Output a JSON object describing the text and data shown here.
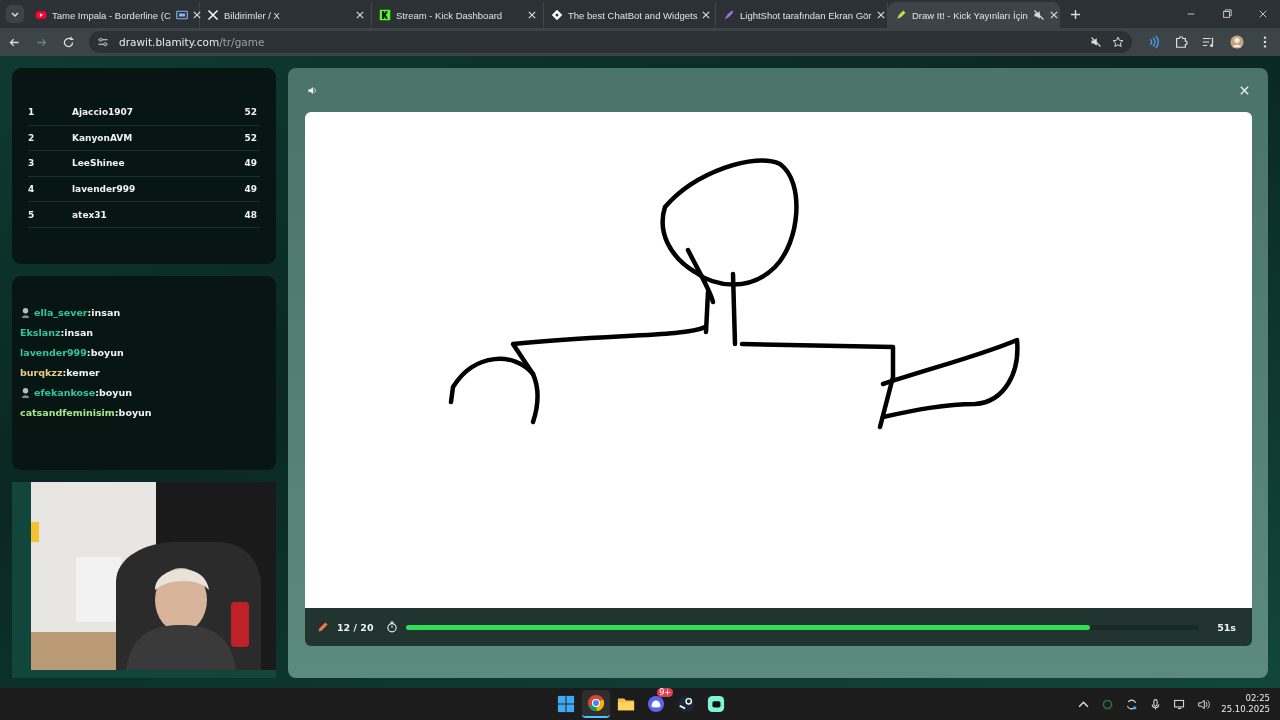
{
  "tabs": [
    {
      "title": "Tame Impala - Borderline (C",
      "kind": "youtube",
      "selected": false,
      "casting": true,
      "muted": false
    },
    {
      "title": "Bildirimler / X",
      "kind": "x",
      "selected": false,
      "casting": false,
      "muted": false
    },
    {
      "title": "Stream - Kick Dashboard",
      "kind": "kick",
      "selected": false,
      "casting": false,
      "muted": false
    },
    {
      "title": "The best ChatBot and Widgets",
      "kind": "chatbot",
      "selected": false,
      "casting": false,
      "muted": false
    },
    {
      "title": "LightShot tarafından Ekran Gör",
      "kind": "feather",
      "selected": false,
      "casting": false,
      "muted": false
    },
    {
      "title": "Draw It! - Kick Yayınları İçin",
      "kind": "drawit",
      "selected": true,
      "casting": false,
      "muted": true
    }
  ],
  "address_bar": {
    "host": "drawit.blamity.com",
    "path": "/tr/game"
  },
  "leaderboard": [
    {
      "rank": "1",
      "name": "Ajaccio1907",
      "score": "52"
    },
    {
      "rank": "2",
      "name": "KanyonAVM",
      "score": "52"
    },
    {
      "rank": "3",
      "name": "LeeShinee",
      "score": "49"
    },
    {
      "rank": "4",
      "name": "lavender999",
      "score": "49"
    },
    {
      "rank": "5",
      "name": "atex31",
      "score": "48"
    }
  ],
  "chat": [
    {
      "user": "ella_sever",
      "message": ":insan",
      "color": "#2fc79a",
      "badge": true
    },
    {
      "user": "Ekslanz",
      "message": ":insan",
      "color": "#2fc79a",
      "badge": false
    },
    {
      "user": "lavender999",
      "message": ":boyun",
      "color": "#2fc79a",
      "badge": false
    },
    {
      "user": "burqkzz",
      "message": ":kemer",
      "color": "#e9c98a",
      "badge": false
    },
    {
      "user": "efekankose",
      "message": ":boyun",
      "color": "#2fc79a",
      "badge": true
    },
    {
      "user": "catsandfeminisim",
      "message": ":boyun",
      "color": "#a6e88a",
      "badge": false
    }
  ],
  "game": {
    "round": "12 / 20",
    "time_left": "51s",
    "level": 0.863
  },
  "taskbar": {
    "apps": [
      {
        "kind": "windows",
        "active": false
      },
      {
        "kind": "chrome",
        "active": true
      },
      {
        "kind": "folder",
        "active": false
      },
      {
        "kind": "discord",
        "active": false,
        "badge": "9+"
      },
      {
        "kind": "steam",
        "active": false
      },
      {
        "kind": "streamlabs",
        "active": false
      }
    ],
    "time": "02:25",
    "date": "25.10.2025"
  }
}
